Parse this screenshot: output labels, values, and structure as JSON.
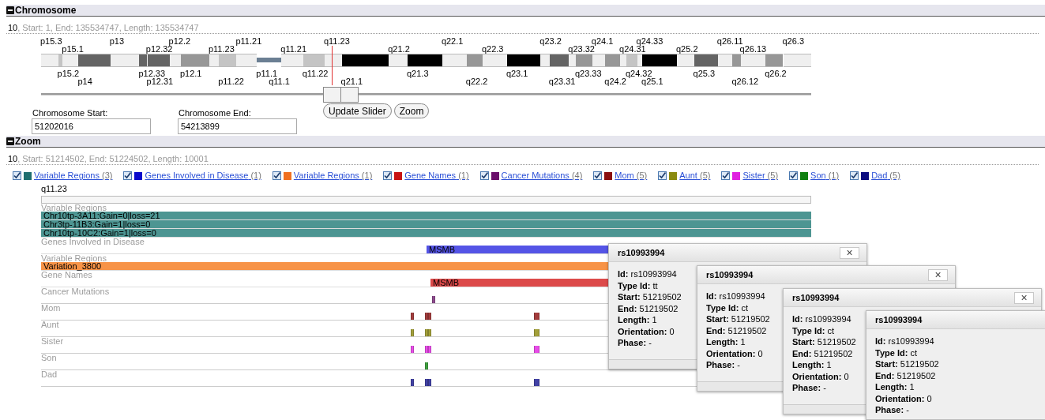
{
  "chromosome_panel": {
    "title": "Chromosome",
    "expanded": true,
    "summary": {
      "name": "10",
      "details": ", Start: 1, End: 135534747, Length: 135534747"
    },
    "band_labels": [
      "p15.3",
      "p15.2",
      "p15.1",
      "p14",
      "p13",
      "p12.33",
      "p12.32",
      "p12.31",
      "p12.2",
      "p12.1",
      "p11.23",
      "p11.22",
      "p11.21",
      "p11.1",
      "q11.1",
      "q11.21",
      "q11.22",
      "q11.23",
      "q21.1",
      "q21.2",
      "q21.3",
      "q22.1",
      "q22.2",
      "q22.3",
      "q23.1",
      "q23.2",
      "q23.31",
      "q23.32",
      "q23.33",
      "q24.1",
      "q24.2",
      "q24.31",
      "q24.32",
      "q24.33",
      "q25.1",
      "q25.2",
      "q25.3",
      "q26.11",
      "q26.12",
      "q26.13",
      "q26.2",
      "q26.3"
    ],
    "start_field": {
      "label": "Chromosome Start:",
      "value": "51202016"
    },
    "end_field": {
      "label": "Chromosome End:",
      "value": "54213899"
    },
    "buttons": [
      "Update Slider",
      "Zoom"
    ]
  },
  "zoom_panel": {
    "title": "Zoom",
    "expanded": true,
    "summary": {
      "name": "10",
      "details": ", Start: 51214502, End: 51224502, Length: 10001"
    },
    "legend": [
      {
        "checked": true,
        "color": "#1f6e6e",
        "label": "Variable Regions",
        "count": "(3)"
      },
      {
        "checked": true,
        "color": "#0a0acc",
        "label": "Genes Involved in Disease",
        "count": "(1)"
      },
      {
        "checked": true,
        "color": "#f07020",
        "label": "Variable Regions",
        "count": "(1)"
      },
      {
        "checked": true,
        "color": "#c81414",
        "label": "Gene Names",
        "count": "(1)"
      },
      {
        "checked": true,
        "color": "#6a0e6a",
        "label": "Cancer Mutations",
        "count": "(4)"
      },
      {
        "checked": true,
        "color": "#8b1010",
        "label": "Mom",
        "count": "(5)"
      },
      {
        "checked": true,
        "color": "#8b8b10",
        "label": "Aunt",
        "count": "(5)"
      },
      {
        "checked": true,
        "color": "#e020e0",
        "label": "Sister",
        "count": "(5)"
      },
      {
        "checked": true,
        "color": "#108010",
        "label": "Son",
        "count": "(1)"
      },
      {
        "checked": true,
        "color": "#0c0c80",
        "label": "Dad",
        "count": "(5)"
      }
    ],
    "region_label": "q11.23",
    "tracks": [
      {
        "name": "Variable Regions",
        "kind": "bars",
        "color": "#4d9592",
        "features": [
          "Chr10tp-3A11:Gain=0|loss=21",
          "Chr3tp-11B3:Gain=1|loss=0",
          "Chr10tp-10C2:Gain=1|loss=0"
        ]
      },
      {
        "name": "Genes Involved in Disease",
        "kind": "bars",
        "color": "#5454e6",
        "features": [
          "MSMB"
        ]
      },
      {
        "name": "Variable Regions",
        "kind": "bars",
        "color": "#f79347",
        "features": [
          "Variation_3800"
        ]
      },
      {
        "name": "Gene Names",
        "kind": "bars",
        "color": "#dc4a4a",
        "features": [
          "MSMB"
        ]
      },
      {
        "name": "Cancer Mutations",
        "kind": "marks",
        "color": "#8e4a8e"
      },
      {
        "name": "Mom",
        "kind": "marks",
        "color": "#a33c3c"
      },
      {
        "name": "Aunt",
        "kind": "marks",
        "color": "#a3a03a"
      },
      {
        "name": "Sister",
        "kind": "marks",
        "color": "#e84ce8"
      },
      {
        "name": "Son",
        "kind": "marks",
        "color": "#3fa03f"
      },
      {
        "name": "Dad",
        "kind": "marks",
        "color": "#4242a6"
      }
    ]
  },
  "popups": [
    {
      "title": "rs10993994",
      "close": "×",
      "fields": [
        {
          "label": "Id:",
          "value": "rs10993994"
        },
        {
          "label": "Type Id:",
          "value": "tt"
        },
        {
          "label": "Start:",
          "value": "51219502"
        },
        {
          "label": "End:",
          "value": "51219502"
        },
        {
          "label": "Length:",
          "value": "1"
        },
        {
          "label": "Orientation:",
          "value": "0"
        },
        {
          "label": "Phase:",
          "value": "-"
        }
      ]
    },
    {
      "title": "rs10993994",
      "close": "×",
      "fields": [
        {
          "label": "Id:",
          "value": "rs10993994"
        },
        {
          "label": "Type Id:",
          "value": "ct"
        },
        {
          "label": "Start:",
          "value": "51219502"
        },
        {
          "label": "End:",
          "value": "51219502"
        },
        {
          "label": "Length:",
          "value": "1"
        },
        {
          "label": "Orientation:",
          "value": "0"
        },
        {
          "label": "Phase:",
          "value": "-"
        }
      ]
    },
    {
      "title": "rs10993994",
      "close": "×",
      "fields": [
        {
          "label": "Id:",
          "value": "rs10993994"
        },
        {
          "label": "Type Id:",
          "value": "ct"
        },
        {
          "label": "Start:",
          "value": "51219502"
        },
        {
          "label": "End:",
          "value": "51219502"
        },
        {
          "label": "Length:",
          "value": "1"
        },
        {
          "label": "Orientation:",
          "value": "0"
        },
        {
          "label": "Phase:",
          "value": "-"
        }
      ]
    },
    {
      "title": "rs10993994",
      "fields": [
        {
          "label": "Id:",
          "value": "rs10993994"
        },
        {
          "label": "Type Id:",
          "value": "ct"
        },
        {
          "label": "Start:",
          "value": "51219502"
        },
        {
          "label": "End:",
          "value": "51219502"
        },
        {
          "label": "Length:",
          "value": "1"
        },
        {
          "label": "Orientation:",
          "value": "0"
        },
        {
          "label": "Phase:",
          "value": "-"
        }
      ]
    }
  ]
}
